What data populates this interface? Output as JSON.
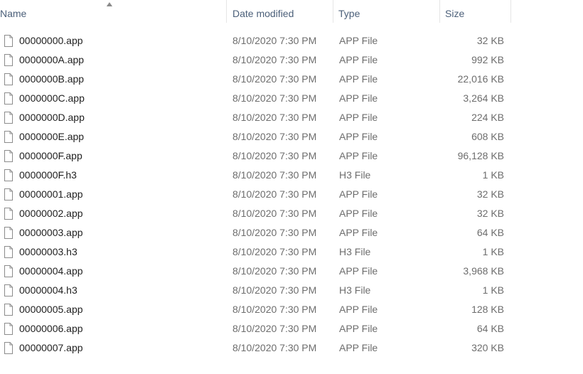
{
  "columns": {
    "name": "Name",
    "date": "Date modified",
    "type": "Type",
    "size": "Size"
  },
  "sort": {
    "column": "name",
    "direction": "ascending"
  },
  "files": [
    {
      "name": "00000000.app",
      "date": "8/10/2020 7:30 PM",
      "type": "APP File",
      "size": "32 KB"
    },
    {
      "name": "0000000A.app",
      "date": "8/10/2020 7:30 PM",
      "type": "APP File",
      "size": "992 KB"
    },
    {
      "name": "0000000B.app",
      "date": "8/10/2020 7:30 PM",
      "type": "APP File",
      "size": "22,016 KB"
    },
    {
      "name": "0000000C.app",
      "date": "8/10/2020 7:30 PM",
      "type": "APP File",
      "size": "3,264 KB"
    },
    {
      "name": "0000000D.app",
      "date": "8/10/2020 7:30 PM",
      "type": "APP File",
      "size": "224 KB"
    },
    {
      "name": "0000000E.app",
      "date": "8/10/2020 7:30 PM",
      "type": "APP File",
      "size": "608 KB"
    },
    {
      "name": "0000000F.app",
      "date": "8/10/2020 7:30 PM",
      "type": "APP File",
      "size": "96,128 KB"
    },
    {
      "name": "0000000F.h3",
      "date": "8/10/2020 7:30 PM",
      "type": "H3 File",
      "size": "1 KB"
    },
    {
      "name": "00000001.app",
      "date": "8/10/2020 7:30 PM",
      "type": "APP File",
      "size": "32 KB"
    },
    {
      "name": "00000002.app",
      "date": "8/10/2020 7:30 PM",
      "type": "APP File",
      "size": "32 KB"
    },
    {
      "name": "00000003.app",
      "date": "8/10/2020 7:30 PM",
      "type": "APP File",
      "size": "64 KB"
    },
    {
      "name": "00000003.h3",
      "date": "8/10/2020 7:30 PM",
      "type": "H3 File",
      "size": "1 KB"
    },
    {
      "name": "00000004.app",
      "date": "8/10/2020 7:30 PM",
      "type": "APP File",
      "size": "3,968 KB"
    },
    {
      "name": "00000004.h3",
      "date": "8/10/2020 7:30 PM",
      "type": "H3 File",
      "size": "1 KB"
    },
    {
      "name": "00000005.app",
      "date": "8/10/2020 7:30 PM",
      "type": "APP File",
      "size": "128 KB"
    },
    {
      "name": "00000006.app",
      "date": "8/10/2020 7:30 PM",
      "type": "APP File",
      "size": "64 KB"
    },
    {
      "name": "00000007.app",
      "date": "8/10/2020 7:30 PM",
      "type": "APP File",
      "size": "320 KB"
    }
  ],
  "file_icon": "blank-document-icon",
  "colors": {
    "header_text": "#4c607a",
    "name_text": "#1f1f1f",
    "detail_text": "#6d6d6d",
    "separator": "#e5e5e5"
  }
}
